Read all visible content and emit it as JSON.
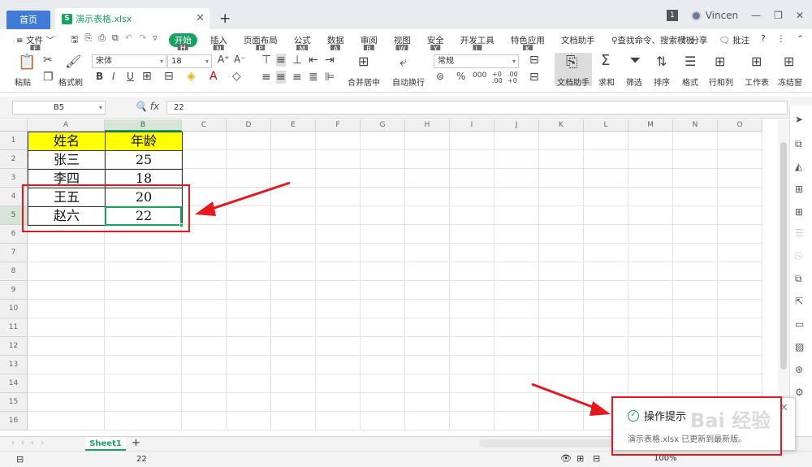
{
  "titlebar": {
    "home_tab": "首页",
    "file_tab": "演示表格.xlsx",
    "file_icon_letter": "S",
    "new_tab": "+",
    "badge": "1",
    "username": "Vincen"
  },
  "menubar": {
    "file": "文件",
    "file_key": "F",
    "tabs": [
      {
        "label": "开始",
        "key": "H"
      },
      {
        "label": "插入",
        "key": "N"
      },
      {
        "label": "页面布局",
        "key": "P"
      },
      {
        "label": "公式",
        "key": "M"
      },
      {
        "label": "数据",
        "key": "A"
      },
      {
        "label": "审阅",
        "key": "R"
      },
      {
        "label": "视图",
        "key": "W"
      },
      {
        "label": "安全",
        "key": "Y"
      },
      {
        "label": "开发工具",
        "key": "L"
      },
      {
        "label": "特色应用",
        "key": "K"
      },
      {
        "label": "文档助手",
        "key": ""
      }
    ],
    "search": "查找命令、搜索模板",
    "share": "分享",
    "comment": "批注",
    "help": "?"
  },
  "ribbon": {
    "paste": "粘贴",
    "format_painter": "格式刷",
    "font_name": "宋体",
    "font_size": "18",
    "bold": "B",
    "italic": "I",
    "underline": "U",
    "merge": "合并居中",
    "wrap": "自动换行",
    "number_format": "常规",
    "percent": "%",
    "thousands": "000",
    "inc_decimal": "+0 .00",
    "dec_decimal": ".00 +0",
    "doc_helper": "文档助手",
    "sum": "求和",
    "filter": "筛选",
    "sort": "排序",
    "format": "格式",
    "row_col": "行和列",
    "worksheet": "工作表",
    "freeze": "冻结窗"
  },
  "formula": {
    "cell_ref": "B5",
    "fx": "fx",
    "value": "22"
  },
  "columns": [
    "A",
    "B",
    "C",
    "D",
    "E",
    "F",
    "G",
    "H",
    "I",
    "J",
    "K",
    "L",
    "M",
    "N",
    "O"
  ],
  "rows": [
    "1",
    "2",
    "3",
    "4",
    "5",
    "6",
    "7",
    "8",
    "9",
    "10",
    "11",
    "12",
    "13",
    "14",
    "15",
    "16"
  ],
  "table": {
    "headers": [
      "姓名",
      "年龄"
    ],
    "rows": [
      [
        "张三",
        "25"
      ],
      [
        "李四",
        "18"
      ],
      [
        "王五",
        "20"
      ],
      [
        "赵六",
        "22"
      ]
    ]
  },
  "sheets": {
    "active": "Sheet1",
    "add": "+"
  },
  "status": {
    "value": "22",
    "zoom": "100%"
  },
  "toast": {
    "title": "操作提示",
    "message": "演示表格.xlsx 已更新到最新版。"
  },
  "watermark": "Bai 经验"
}
